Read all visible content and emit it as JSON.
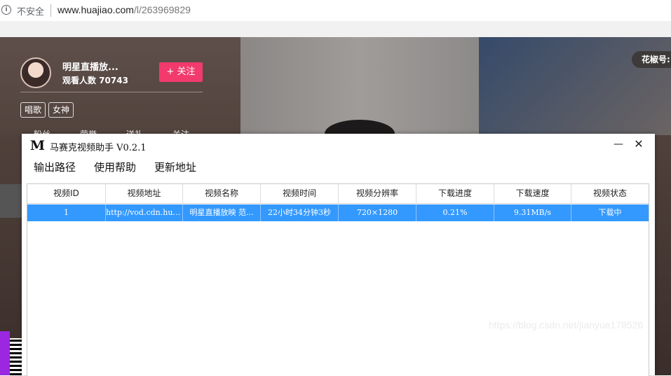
{
  "browser": {
    "security_label": "不安全",
    "url_host": "www.huajiao.com",
    "url_path": "/l/263969829"
  },
  "stream": {
    "anchor_name": "明星直播放...",
    "viewers": "观看人数 70743",
    "follow_label": "+ 关注",
    "tags": [
      "唱歌",
      "女神"
    ],
    "tabs": [
      "粉丝",
      "荣誉",
      "送礼",
      "关注"
    ],
    "huajiao_id_label": "花椒号:",
    "watermark": "https://blog.csdn.net/jianyue178526"
  },
  "app": {
    "logo": "M",
    "title": "马赛克视频助手 V0.2.1",
    "min_glyph": "—",
    "close_glyph": "✕",
    "menu": [
      "输出路径",
      "使用帮助",
      "更新地址"
    ],
    "columns": [
      "视频ID",
      "视频地址",
      "视频名称",
      "视频时间",
      "视频分辨率",
      "下载进度",
      "下载速度",
      "视频状态"
    ],
    "rows": [
      [
        "1",
        "http://vod.cdn.huajiao.com",
        "明星直播放映 范...",
        "22小时34分钟3秒",
        "720×1280",
        "0.21%",
        "9.31MB/s",
        "下载中"
      ]
    ]
  }
}
